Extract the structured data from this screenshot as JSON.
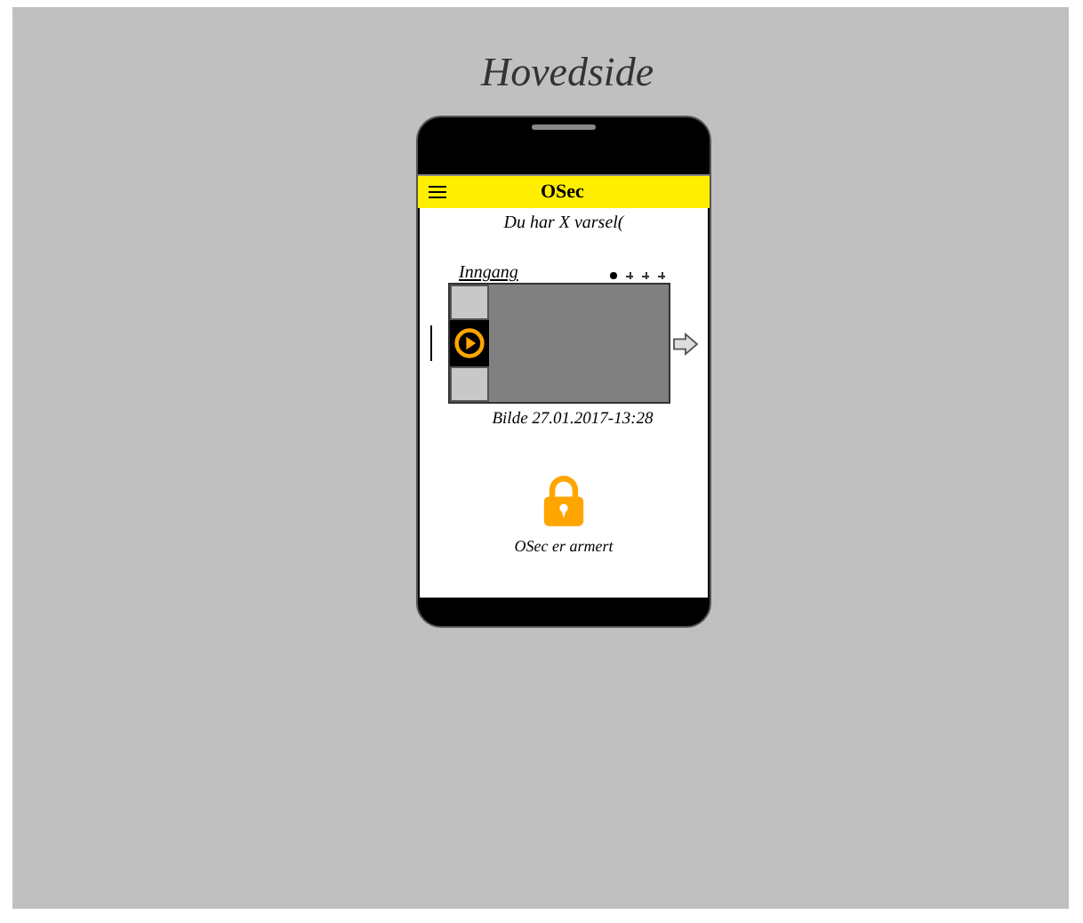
{
  "page_title": "Hovedside",
  "app_bar": {
    "title": "OSec"
  },
  "notice": "Du har X varsel(",
  "camera": {
    "label": "Inngang",
    "pages": [
      {
        "selected": true
      },
      {
        "selected": false
      },
      {
        "selected": false
      },
      {
        "selected": false
      }
    ],
    "caption": "Bilde  27.01.2017-13:28"
  },
  "status": {
    "armed": true,
    "label": "OSec er armert"
  }
}
